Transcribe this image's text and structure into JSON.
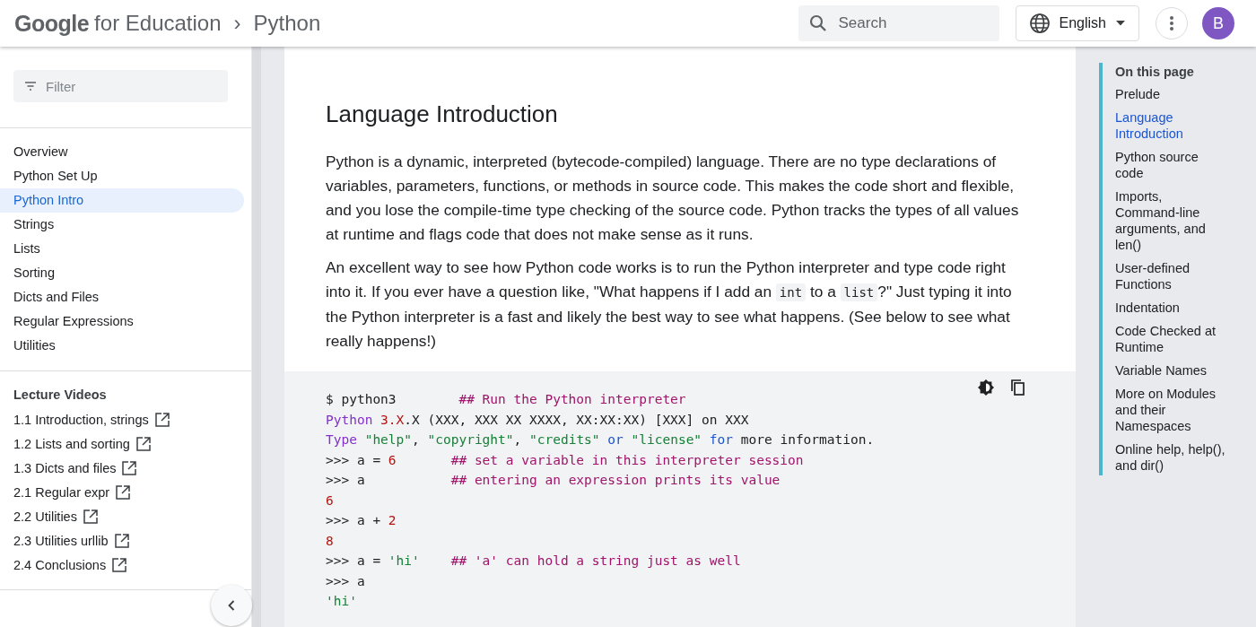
{
  "header": {
    "brand": "Google",
    "brand_suffix": "for Education",
    "breadcrumb_separator": "›",
    "breadcrumb": "Python",
    "search": {
      "placeholder": "Search"
    },
    "language": "English",
    "avatar": "B"
  },
  "sidebar": {
    "filter": {
      "placeholder": "Filter"
    },
    "items": [
      {
        "label": "Overview",
        "selected": false
      },
      {
        "label": "Python Set Up",
        "selected": false
      },
      {
        "label": "Python Intro",
        "selected": true
      },
      {
        "label": "Strings",
        "selected": false
      },
      {
        "label": "Lists",
        "selected": false
      },
      {
        "label": "Sorting",
        "selected": false
      },
      {
        "label": "Dicts and Files",
        "selected": false
      },
      {
        "label": "Regular Expressions",
        "selected": false
      },
      {
        "label": "Utilities",
        "selected": false
      }
    ],
    "videos_heading": "Lecture Videos",
    "videos": [
      "1.1 Introduction, strings",
      "1.2 Lists and sorting",
      "1.3 Dicts and files",
      "2.1 Regular expr",
      "2.2 Utilities",
      "2.3 Utilities urllib",
      "2.4 Conclusions"
    ]
  },
  "article": {
    "title": "Language Introduction",
    "paragraphs": [
      [
        {
          "kind": "text",
          "text": "Python is a dynamic, interpreted (bytecode-compiled) language. There are no type declarations of variables, parameters, functions, or methods in source code. This makes the code short and flexible, and you lose the compile-time type checking of the source code. Python tracks the types of all values at runtime and flags code that does not make sense as it runs."
        }
      ],
      [
        {
          "kind": "text",
          "text": "An excellent way to see how Python code works is to run the Python interpreter and type code right into it. If you ever have a question like, \"What happens if I add an "
        },
        {
          "kind": "code",
          "text": "int"
        },
        {
          "kind": "text",
          "text": " to a "
        },
        {
          "kind": "code",
          "text": "list"
        },
        {
          "kind": "text",
          "text": "?\" Just typing it into the Python interpreter is a fast and likely the best way to see what happens. (See below to see what really happens!)"
        }
      ]
    ],
    "code": [
      [
        {
          "kind": "plain",
          "text": "$ python3        "
        },
        {
          "kind": "comment",
          "text": "## Run the Python interpreter"
        }
      ],
      [
        {
          "kind": "keyword",
          "text": "Python "
        },
        {
          "kind": "number",
          "text": "3.X"
        },
        {
          "kind": "plain",
          "text": ".X (XXX, XXX XX XXXX, XX:XX:XX) [XXX] on XXX"
        }
      ],
      [
        {
          "kind": "keyword",
          "text": "Type "
        },
        {
          "kind": "string",
          "text": "\"help\""
        },
        {
          "kind": "plain",
          "text": ", "
        },
        {
          "kind": "string",
          "text": "\"copyright\""
        },
        {
          "kind": "plain",
          "text": ", "
        },
        {
          "kind": "string",
          "text": "\"credits\" "
        },
        {
          "kind": "operator",
          "text": "or "
        },
        {
          "kind": "string",
          "text": "\"license\" "
        },
        {
          "kind": "operator",
          "text": "for"
        },
        {
          "kind": "plain",
          "text": " more information."
        }
      ],
      [
        {
          "kind": "plain",
          "text": ">>> a = "
        },
        {
          "kind": "number",
          "text": "6"
        },
        {
          "kind": "comment",
          "text": "       ## set a variable in this interpreter session"
        }
      ],
      [
        {
          "kind": "plain",
          "text": ">>> a           "
        },
        {
          "kind": "comment",
          "text": "## entering an expression prints its value"
        }
      ],
      [
        {
          "kind": "number",
          "text": "6"
        }
      ],
      [
        {
          "kind": "plain",
          "text": ">>> a + "
        },
        {
          "kind": "number",
          "text": "2"
        }
      ],
      [
        {
          "kind": "number",
          "text": "8"
        }
      ],
      [
        {
          "kind": "plain",
          "text": ">>> a = "
        },
        {
          "kind": "string",
          "text": "'hi'"
        },
        {
          "kind": "comment",
          "text": "    ## 'a' can hold a string just as well"
        }
      ],
      [
        {
          "kind": "plain",
          "text": ">>> a"
        }
      ],
      [
        {
          "kind": "string",
          "text": "'hi'"
        }
      ]
    ]
  },
  "toc": {
    "heading": "On this page",
    "items": [
      {
        "label": "Prelude",
        "selected": false
      },
      {
        "label": "Language Introduction",
        "selected": true
      },
      {
        "label": "Python source code",
        "selected": false
      },
      {
        "label": "Imports, Command-line arguments, and len()",
        "selected": false
      },
      {
        "label": "User-defined Functions",
        "selected": false
      },
      {
        "label": "Indentation",
        "selected": false
      },
      {
        "label": "Code Checked at Runtime",
        "selected": false
      },
      {
        "label": "Variable Names",
        "selected": false
      },
      {
        "label": "More on Modules and their Namespaces",
        "selected": false
      },
      {
        "label": "Online help, help(), and dir()",
        "selected": false
      }
    ]
  }
}
